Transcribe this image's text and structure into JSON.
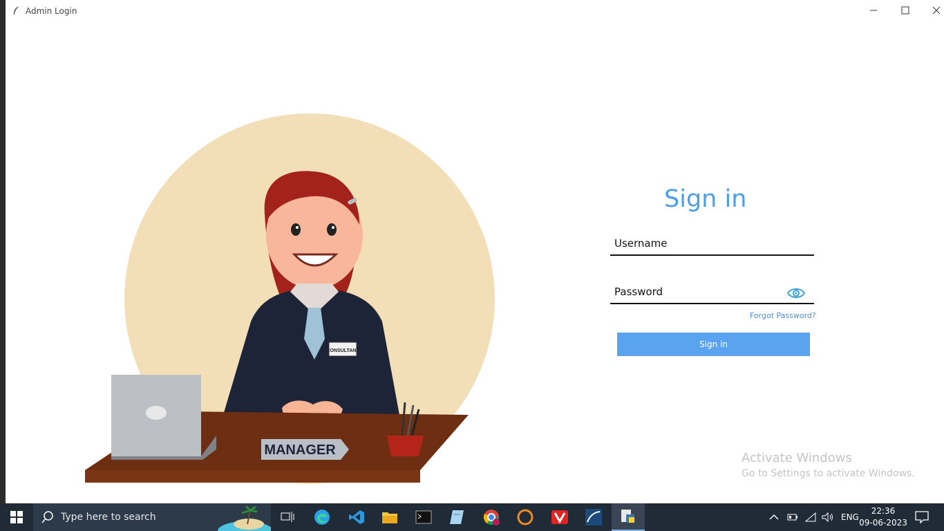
{
  "window": {
    "title": "Admin Login",
    "controls": {
      "minimize": "minimize",
      "maximize": "maximize",
      "close": "close"
    }
  },
  "illustration": {
    "badge": "CONSULTANT",
    "nameplate": "MANAGER"
  },
  "form": {
    "heading": "Sign in",
    "username_placeholder": "Username",
    "password_placeholder": "Password",
    "forgot_label": "Forgot Password?",
    "submit_label": "Sign in"
  },
  "watermark": {
    "line1": "Activate Windows",
    "line2": "Go to Settings to activate Windows."
  },
  "taskbar": {
    "search_placeholder": "Type here to search",
    "apps": [
      "task-view",
      "edge",
      "vscode",
      "file-explorer",
      "terminal",
      "notepad",
      "chrome",
      "eclipse",
      "vivaldi",
      "mysql-workbench",
      "python"
    ],
    "language": "ENG",
    "time": "22:36",
    "date": "09-06-2023"
  },
  "colors": {
    "accent": "#4a9fe8",
    "button": "#5aa3f0",
    "taskbar": "#202b38",
    "circle": "#f2dfb8"
  }
}
